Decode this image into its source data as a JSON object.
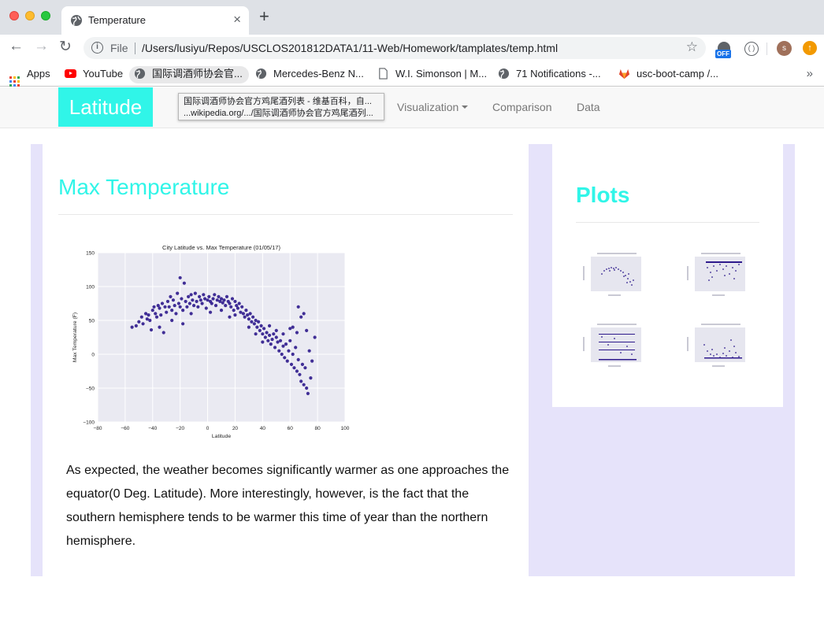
{
  "browser": {
    "tab_title": "Temperature",
    "scheme_label": "File",
    "url": "/Users/lusiyu/Repos/USCLOS201812DATA1/11-Web/Homework/tamplates/temp.html",
    "extension_badge": "OFF",
    "profile_initial": "s",
    "bookmarks": [
      {
        "label": "Apps",
        "icon": "apps-grid-icon"
      },
      {
        "label": "YouTube",
        "icon": "youtube-icon"
      },
      {
        "label": "国际调酒师协会官...",
        "icon": "globe-icon"
      },
      {
        "label": "Mercedes-Benz N...",
        "icon": "globe-icon"
      },
      {
        "label": "W.I. Simonson | M...",
        "icon": "page-icon"
      },
      {
        "label": "71 Notifications -...",
        "icon": "globe-icon"
      },
      {
        "label": "usc-boot-camp /...",
        "icon": "gitlab-icon"
      }
    ],
    "tooltip": {
      "line1": "国际调酒师协会官方鸡尾酒列表 - 维基百科，自...",
      "line2": "...wikipedia.org/.../国际调酒师协会官方鸡尾酒列..."
    }
  },
  "navbar": {
    "brand": "Latitude",
    "links": [
      "Visualization",
      "Comparison",
      "Data"
    ],
    "brand_color": "#30f5e8"
  },
  "main": {
    "heading": "Max Temperature",
    "paragraph": "As expected, the weather becomes significantly warmer as one approaches the equator(0 Deg. Latitude). More interestingly, however, is the fact that the southern hemisphere tends to be warmer this time of year than the northern hemisphere."
  },
  "sidebar": {
    "heading": "Plots",
    "thumbnails": [
      "max-temperature-thumbnail",
      "humidity-thumbnail",
      "cloudiness-thumbnail",
      "wind-speed-thumbnail"
    ]
  },
  "chart_data": {
    "type": "scatter",
    "title": "City Latitude vs. Max Temperature (01/05/17)",
    "xlabel": "Latitude",
    "ylabel": "Max Temperature (F)",
    "xlim": [
      -80,
      100
    ],
    "ylim": [
      -100,
      150
    ],
    "xticks": [
      -80,
      -60,
      -40,
      -20,
      0,
      20,
      40,
      60,
      80,
      100
    ],
    "yticks": [
      -100,
      -50,
      0,
      50,
      100,
      150
    ],
    "grid": true,
    "point_color": "#2e1a8c",
    "points": [
      [
        -55,
        40
      ],
      [
        -52,
        42
      ],
      [
        -50,
        48
      ],
      [
        -48,
        55
      ],
      [
        -47,
        45
      ],
      [
        -45,
        60
      ],
      [
        -44,
        52
      ],
      [
        -43,
        58
      ],
      [
        -42,
        50
      ],
      [
        -40,
        65
      ],
      [
        -39,
        70
      ],
      [
        -38,
        60
      ],
      [
        -37,
        55
      ],
      [
        -36,
        72
      ],
      [
        -35,
        68
      ],
      [
        -34,
        58
      ],
      [
        -33,
        75
      ],
      [
        -32,
        32
      ],
      [
        -31,
        70
      ],
      [
        -30,
        62
      ],
      [
        -29,
        78
      ],
      [
        -28,
        70
      ],
      [
        -27,
        85
      ],
      [
        -26,
        65
      ],
      [
        -25,
        80
      ],
      [
        -24,
        72
      ],
      [
        -23,
        60
      ],
      [
        -22,
        90
      ],
      [
        -21,
        75
      ],
      [
        -20,
        113
      ],
      [
        -20,
        70
      ],
      [
        -19,
        82
      ],
      [
        -18,
        65
      ],
      [
        -17,
        105
      ],
      [
        -16,
        78
      ],
      [
        -15,
        70
      ],
      [
        -14,
        85
      ],
      [
        -13,
        75
      ],
      [
        -12,
        88
      ],
      [
        -11,
        80
      ],
      [
        -10,
        72
      ],
      [
        -9,
        90
      ],
      [
        -8,
        78
      ],
      [
        -7,
        70
      ],
      [
        -6,
        85
      ],
      [
        -5,
        80
      ],
      [
        -4,
        75
      ],
      [
        -3,
        88
      ],
      [
        -2,
        82
      ],
      [
        -1,
        68
      ],
      [
        0,
        80
      ],
      [
        1,
        85
      ],
      [
        2,
        78
      ],
      [
        3,
        75
      ],
      [
        4,
        82
      ],
      [
        5,
        88
      ],
      [
        6,
        72
      ],
      [
        7,
        80
      ],
      [
        8,
        85
      ],
      [
        9,
        78
      ],
      [
        10,
        82
      ],
      [
        11,
        76
      ],
      [
        12,
        80
      ],
      [
        13,
        72
      ],
      [
        14,
        85
      ],
      [
        15,
        78
      ],
      [
        16,
        75
      ],
      [
        17,
        70
      ],
      [
        18,
        82
      ],
      [
        19,
        65
      ],
      [
        20,
        78
      ],
      [
        21,
        72
      ],
      [
        22,
        68
      ],
      [
        23,
        75
      ],
      [
        24,
        62
      ],
      [
        25,
        70
      ],
      [
        26,
        60
      ],
      [
        27,
        55
      ],
      [
        28,
        65
      ],
      [
        29,
        58
      ],
      [
        30,
        52
      ],
      [
        31,
        60
      ],
      [
        32,
        48
      ],
      [
        33,
        55
      ],
      [
        34,
        45
      ],
      [
        35,
        50
      ],
      [
        36,
        40
      ],
      [
        37,
        48
      ],
      [
        38,
        35
      ],
      [
        39,
        42
      ],
      [
        40,
        30
      ],
      [
        41,
        38
      ],
      [
        42,
        25
      ],
      [
        43,
        32
      ],
      [
        44,
        20
      ],
      [
        45,
        28
      ],
      [
        46,
        15
      ],
      [
        47,
        22
      ],
      [
        48,
        30
      ],
      [
        49,
        10
      ],
      [
        50,
        25
      ],
      [
        51,
        18
      ],
      [
        52,
        5
      ],
      [
        53,
        20
      ],
      [
        54,
        0
      ],
      [
        55,
        12
      ],
      [
        56,
        -5
      ],
      [
        57,
        15
      ],
      [
        58,
        -10
      ],
      [
        59,
        5
      ],
      [
        60,
        20
      ],
      [
        61,
        -15
      ],
      [
        62,
        0
      ],
      [
        63,
        -20
      ],
      [
        64,
        10
      ],
      [
        65,
        -25
      ],
      [
        66,
        -8
      ],
      [
        67,
        -30
      ],
      [
        68,
        -40
      ],
      [
        69,
        -15
      ],
      [
        70,
        -45
      ],
      [
        71,
        -20
      ],
      [
        72,
        -50
      ],
      [
        73,
        -58
      ],
      [
        74,
        5
      ],
      [
        75,
        -35
      ],
      [
        76,
        -10
      ],
      [
        78,
        25
      ],
      [
        -18,
        45
      ],
      [
        -35,
        40
      ],
      [
        10,
        65
      ],
      [
        20,
        58
      ],
      [
        30,
        40
      ],
      [
        35,
        30
      ],
      [
        40,
        18
      ],
      [
        45,
        42
      ],
      [
        50,
        35
      ],
      [
        55,
        30
      ],
      [
        60,
        38
      ],
      [
        65,
        32
      ],
      [
        66,
        70
      ],
      [
        70,
        60
      ],
      [
        72,
        35
      ],
      [
        68,
        55
      ],
      [
        62,
        40
      ],
      [
        -12,
        60
      ],
      [
        -26,
        50
      ],
      [
        -41,
        36
      ],
      [
        2,
        62
      ],
      [
        16,
        55
      ]
    ]
  }
}
